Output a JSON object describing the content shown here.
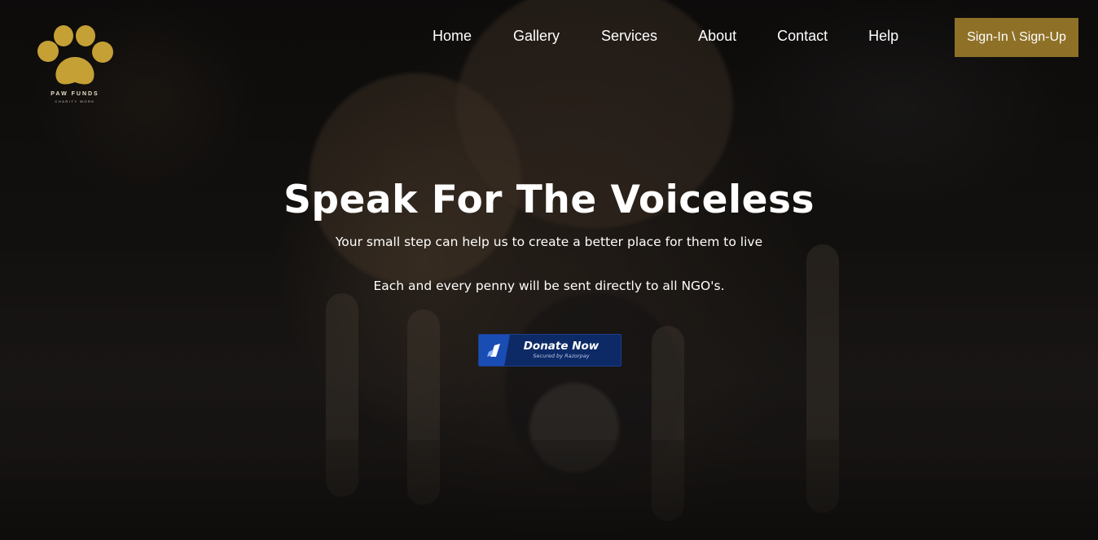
{
  "brand": {
    "name": "PAW FUNDS",
    "tagline": "CHARITY WORK",
    "accent_color": "#c4a035",
    "icon": "paw-icon"
  },
  "nav": {
    "items": [
      {
        "label": "Home"
      },
      {
        "label": "Gallery"
      },
      {
        "label": "Services"
      },
      {
        "label": "About"
      },
      {
        "label": "Contact"
      },
      {
        "label": "Help"
      }
    ],
    "signin_label": "Sign-In \\ Sign-Up",
    "signin_color": "#8e7127"
  },
  "hero": {
    "headline": "Speak For The Voiceless",
    "subtitle": "Your small step can help us to create a better place for them to live",
    "note": "Each and every penny will be sent directly to all NGO's."
  },
  "donate": {
    "label": "Donate Now",
    "secured": "Secured by Razorpay",
    "icon": "razorpay-icon",
    "color": "#0d2a66"
  }
}
